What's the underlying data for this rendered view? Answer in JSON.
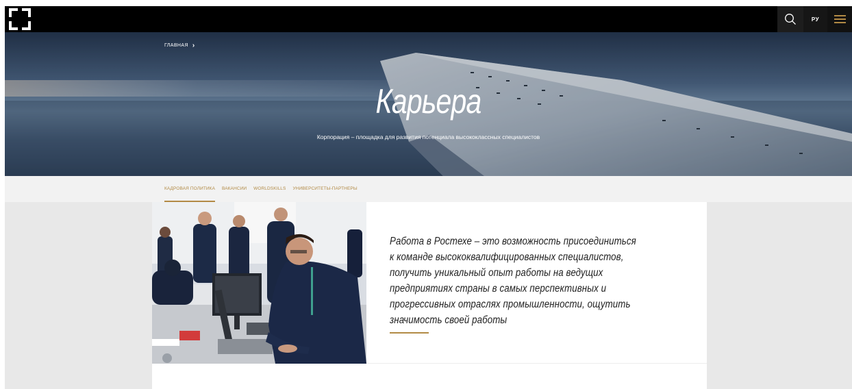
{
  "header": {
    "logo_icon": "bracket-frame-logo",
    "search_icon": "search-icon",
    "lang_label": "РУ",
    "menu_icon": "hamburger-menu-icon",
    "accent_color": "#b28a45"
  },
  "breadcrumb": {
    "home_label": "ГЛАВНАЯ",
    "separator_icon": "chevron-right-icon"
  },
  "hero": {
    "title": "Карьера",
    "subtitle": "Корпорация – площадка для развития потенциала высококлассных специалистов"
  },
  "tabs": [
    {
      "label": "КАДРОВАЯ ПОЛИТИКА",
      "active": true
    },
    {
      "label": "ВАКАНСИИ",
      "active": false
    },
    {
      "label": "WORLDSKILLS",
      "active": false
    },
    {
      "label": "УНИВЕРСИТЕТЫ-ПАРТНЕРЫ",
      "active": false
    }
  ],
  "content": {
    "quote": "Работа в Ростехе – это возможность присоединиться к команде высококвалифицированных специалистов, получить уникальный опыт работы на ведущих предприятиях страны в самых перспективных и прогрессивных отраслях промышленности, ощутить значимость своей работы"
  }
}
